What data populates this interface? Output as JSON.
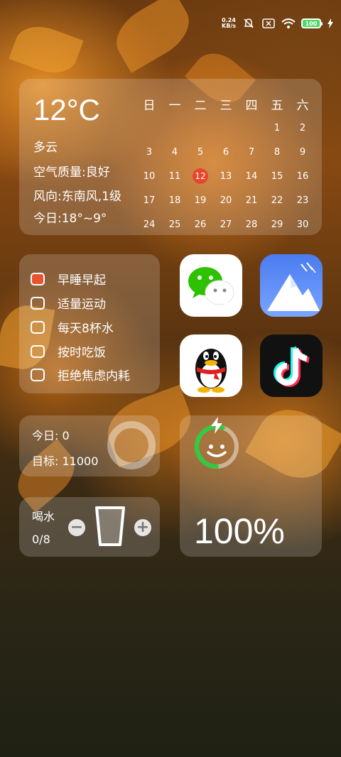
{
  "status_bar": {
    "net_speed_value": "0.24",
    "net_speed_unit": "KB/s",
    "battery_level": "100",
    "icons": [
      "mute-bell-icon",
      "no-sim-icon",
      "wifi-icon",
      "battery-icon",
      "charging-bolt-icon"
    ]
  },
  "weather": {
    "temperature": "12°C",
    "condition": "多云",
    "air_quality": "空气质量:良好",
    "wind": "风向:东南风,1级",
    "today_range": "今日:18°~9°"
  },
  "calendar": {
    "weekdays": [
      "日",
      "一",
      "二",
      "三",
      "四",
      "五",
      "六"
    ],
    "weeks": [
      [
        "",
        "",
        "",
        "",
        "",
        "1",
        "2"
      ],
      [
        "3",
        "4",
        "5",
        "6",
        "7",
        "8",
        "9"
      ],
      [
        "10",
        "11",
        "12",
        "13",
        "14",
        "15",
        "16"
      ],
      [
        "17",
        "18",
        "19",
        "20",
        "21",
        "22",
        "23"
      ],
      [
        "24",
        "25",
        "26",
        "27",
        "28",
        "29",
        "30"
      ]
    ],
    "today": "12",
    "today_color": "#e8452c"
  },
  "todo": {
    "items": [
      {
        "label": "早睡早起",
        "active": true
      },
      {
        "label": "适量运动",
        "active": false
      },
      {
        "label": "每天8杯水",
        "active": false
      },
      {
        "label": "按时吃饭",
        "active": false
      },
      {
        "label": "拒绝焦虑内耗",
        "active": false
      }
    ]
  },
  "apps": [
    {
      "name": "wechat",
      "icon": "wechat-icon"
    },
    {
      "name": "gallery",
      "icon": "gallery-mountain-icon"
    },
    {
      "name": "qq",
      "icon": "qq-penguin-icon"
    },
    {
      "name": "tiktok",
      "icon": "tiktok-icon"
    }
  ],
  "steps": {
    "today": "今日: 0",
    "goal": "目标: 11000"
  },
  "water": {
    "title": "喝水",
    "count": "0/8",
    "minus_label": "−",
    "plus_label": "+"
  },
  "battery_widget": {
    "percent": "100%",
    "ring_color": "#2ecc40",
    "level": 1.0
  }
}
